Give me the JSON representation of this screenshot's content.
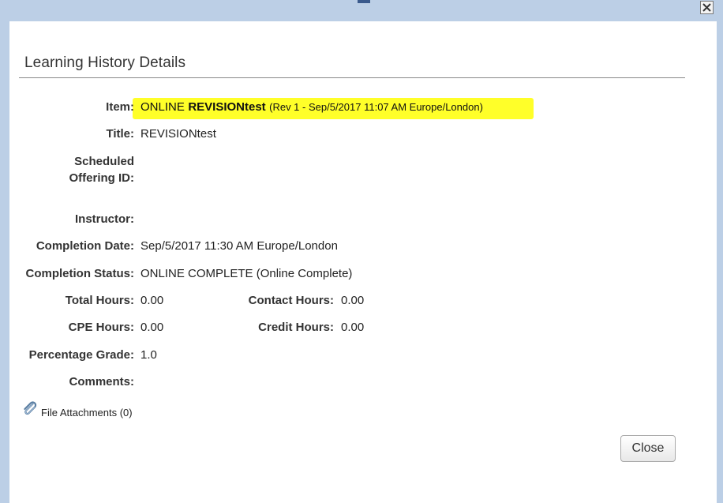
{
  "window": {
    "close_icon": "close-x-icon"
  },
  "dialog": {
    "title": "Learning History Details",
    "fields": {
      "item": {
        "label": "Item:",
        "prefix": "ONLINE",
        "name": "REVISIONtest",
        "revision": "(Rev 1 - Sep/5/2017 11:07 AM Europe/London)",
        "highlight_color": "#ffff29"
      },
      "title": {
        "label": "Title:",
        "value": "REVISIONtest"
      },
      "scheduled_offering": {
        "label_line1": "Scheduled",
        "label_line2": "Offering ID:",
        "value": ""
      },
      "instructor": {
        "label": "Instructor:",
        "value": ""
      },
      "completion_date": {
        "label": "Completion Date:",
        "value": "Sep/5/2017 11:30 AM Europe/London"
      },
      "completion_status": {
        "label": "Completion Status:",
        "value": "ONLINE COMPLETE (Online Complete)"
      },
      "total_hours": {
        "label": "Total Hours:",
        "value": "0.00"
      },
      "contact_hours": {
        "label": "Contact Hours:",
        "value": "0.00"
      },
      "cpe_hours": {
        "label": "CPE Hours:",
        "value": "0.00"
      },
      "credit_hours": {
        "label": "Credit Hours:",
        "value": "0.00"
      },
      "percentage_grade": {
        "label": "Percentage Grade:",
        "value": "1.0"
      },
      "comments": {
        "label": "Comments:",
        "value": ""
      }
    },
    "attachments": {
      "icon": "paperclip-icon",
      "label": "File Attachments (0)"
    },
    "close_button": "Close"
  }
}
